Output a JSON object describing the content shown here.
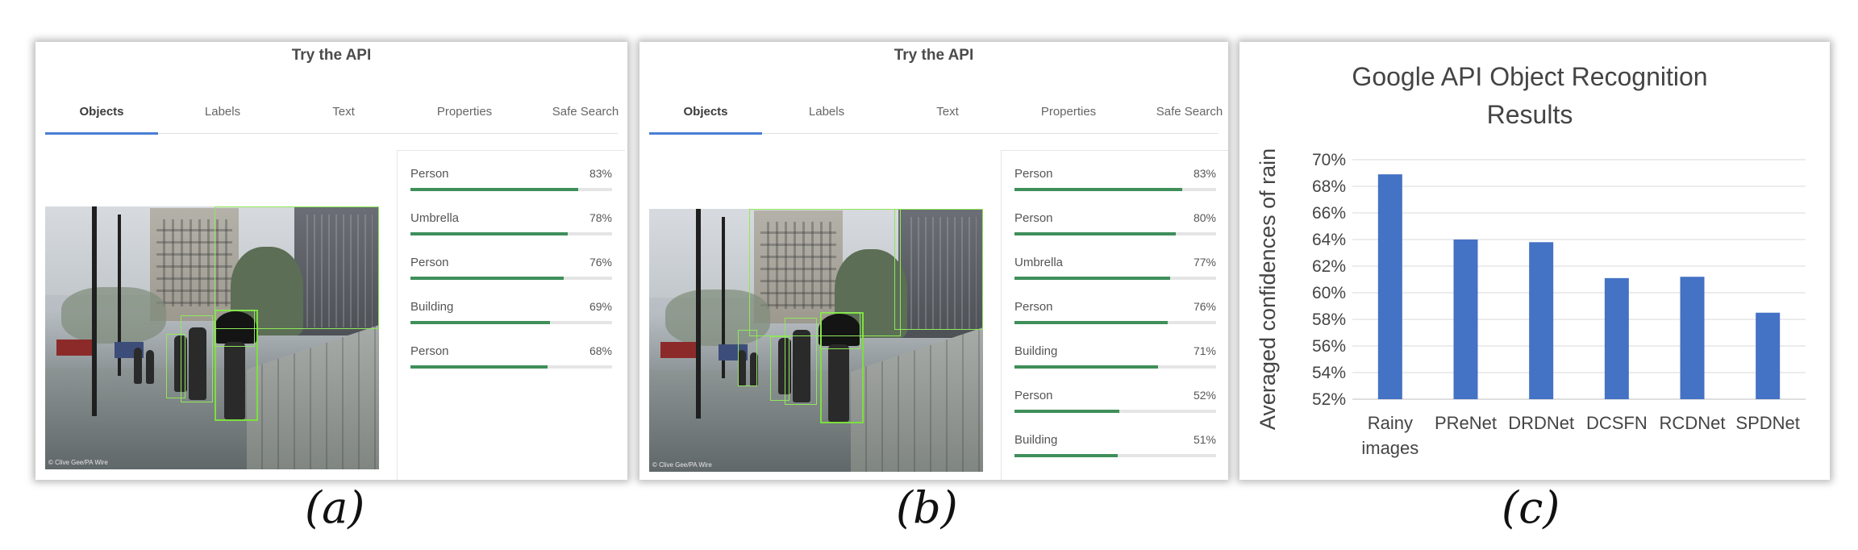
{
  "panels": [
    {
      "title": "Try the API",
      "tabs": [
        "Objects",
        "Labels",
        "Text",
        "Properties",
        "Safe Search"
      ],
      "active_tab": 0,
      "image_credit": "© Clive Gee/PA Wire",
      "results": [
        {
          "label": "Person",
          "score": "83%",
          "fraction": 0.83
        },
        {
          "label": "Umbrella",
          "score": "78%",
          "fraction": 0.78
        },
        {
          "label": "Person",
          "score": "76%",
          "fraction": 0.76
        },
        {
          "label": "Building",
          "score": "69%",
          "fraction": 0.69
        },
        {
          "label": "Person",
          "score": "68%",
          "fraction": 0.68
        }
      ],
      "caption": "(a)"
    },
    {
      "title": "Try the API",
      "tabs": [
        "Objects",
        "Labels",
        "Text",
        "Properties",
        "Safe Search"
      ],
      "active_tab": 0,
      "image_credit": "© Clive Gee/PA Wire",
      "results": [
        {
          "label": "Person",
          "score": "83%",
          "fraction": 0.83
        },
        {
          "label": "Person",
          "score": "80%",
          "fraction": 0.8
        },
        {
          "label": "Umbrella",
          "score": "77%",
          "fraction": 0.77
        },
        {
          "label": "Person",
          "score": "76%",
          "fraction": 0.76
        },
        {
          "label": "Building",
          "score": "71%",
          "fraction": 0.71
        },
        {
          "label": "Person",
          "score": "52%",
          "fraction": 0.52
        },
        {
          "label": "Building",
          "score": "51%",
          "fraction": 0.51
        }
      ],
      "caption": "(b)"
    }
  ],
  "colors": {
    "tab_accent": "#4a7fd6",
    "score_bar": "#3f8f5a",
    "bounding_box": "#7ddf3f",
    "chart_bar": "#4472c4"
  },
  "chart_caption": "(c)",
  "chart_data": {
    "type": "bar",
    "title": "Google API Object Recognition Results",
    "title_lines": [
      "Google API Object Recognition",
      "Results"
    ],
    "xlabel": "",
    "ylabel": "Averaged confidences of rain",
    "categories": [
      "Rainy images",
      "PReNet",
      "DRDNet",
      "DCSFN",
      "RCDNet",
      "SPDNet"
    ],
    "category_lines": [
      [
        "Rainy",
        "images"
      ],
      [
        "PReNet"
      ],
      [
        "DRDNet"
      ],
      [
        "DCSFN"
      ],
      [
        "RCDNet"
      ],
      [
        "SPDNet"
      ]
    ],
    "values": [
      68.9,
      64.0,
      63.8,
      61.1,
      61.2,
      58.5
    ],
    "ylim": [
      52,
      70
    ],
    "yticks": [
      52,
      54,
      56,
      58,
      60,
      62,
      64,
      66,
      68,
      70
    ],
    "ytick_labels": [
      "52%",
      "54%",
      "56%",
      "58%",
      "60%",
      "62%",
      "64%",
      "66%",
      "68%",
      "70%"
    ],
    "grid": true,
    "legend": "none"
  }
}
